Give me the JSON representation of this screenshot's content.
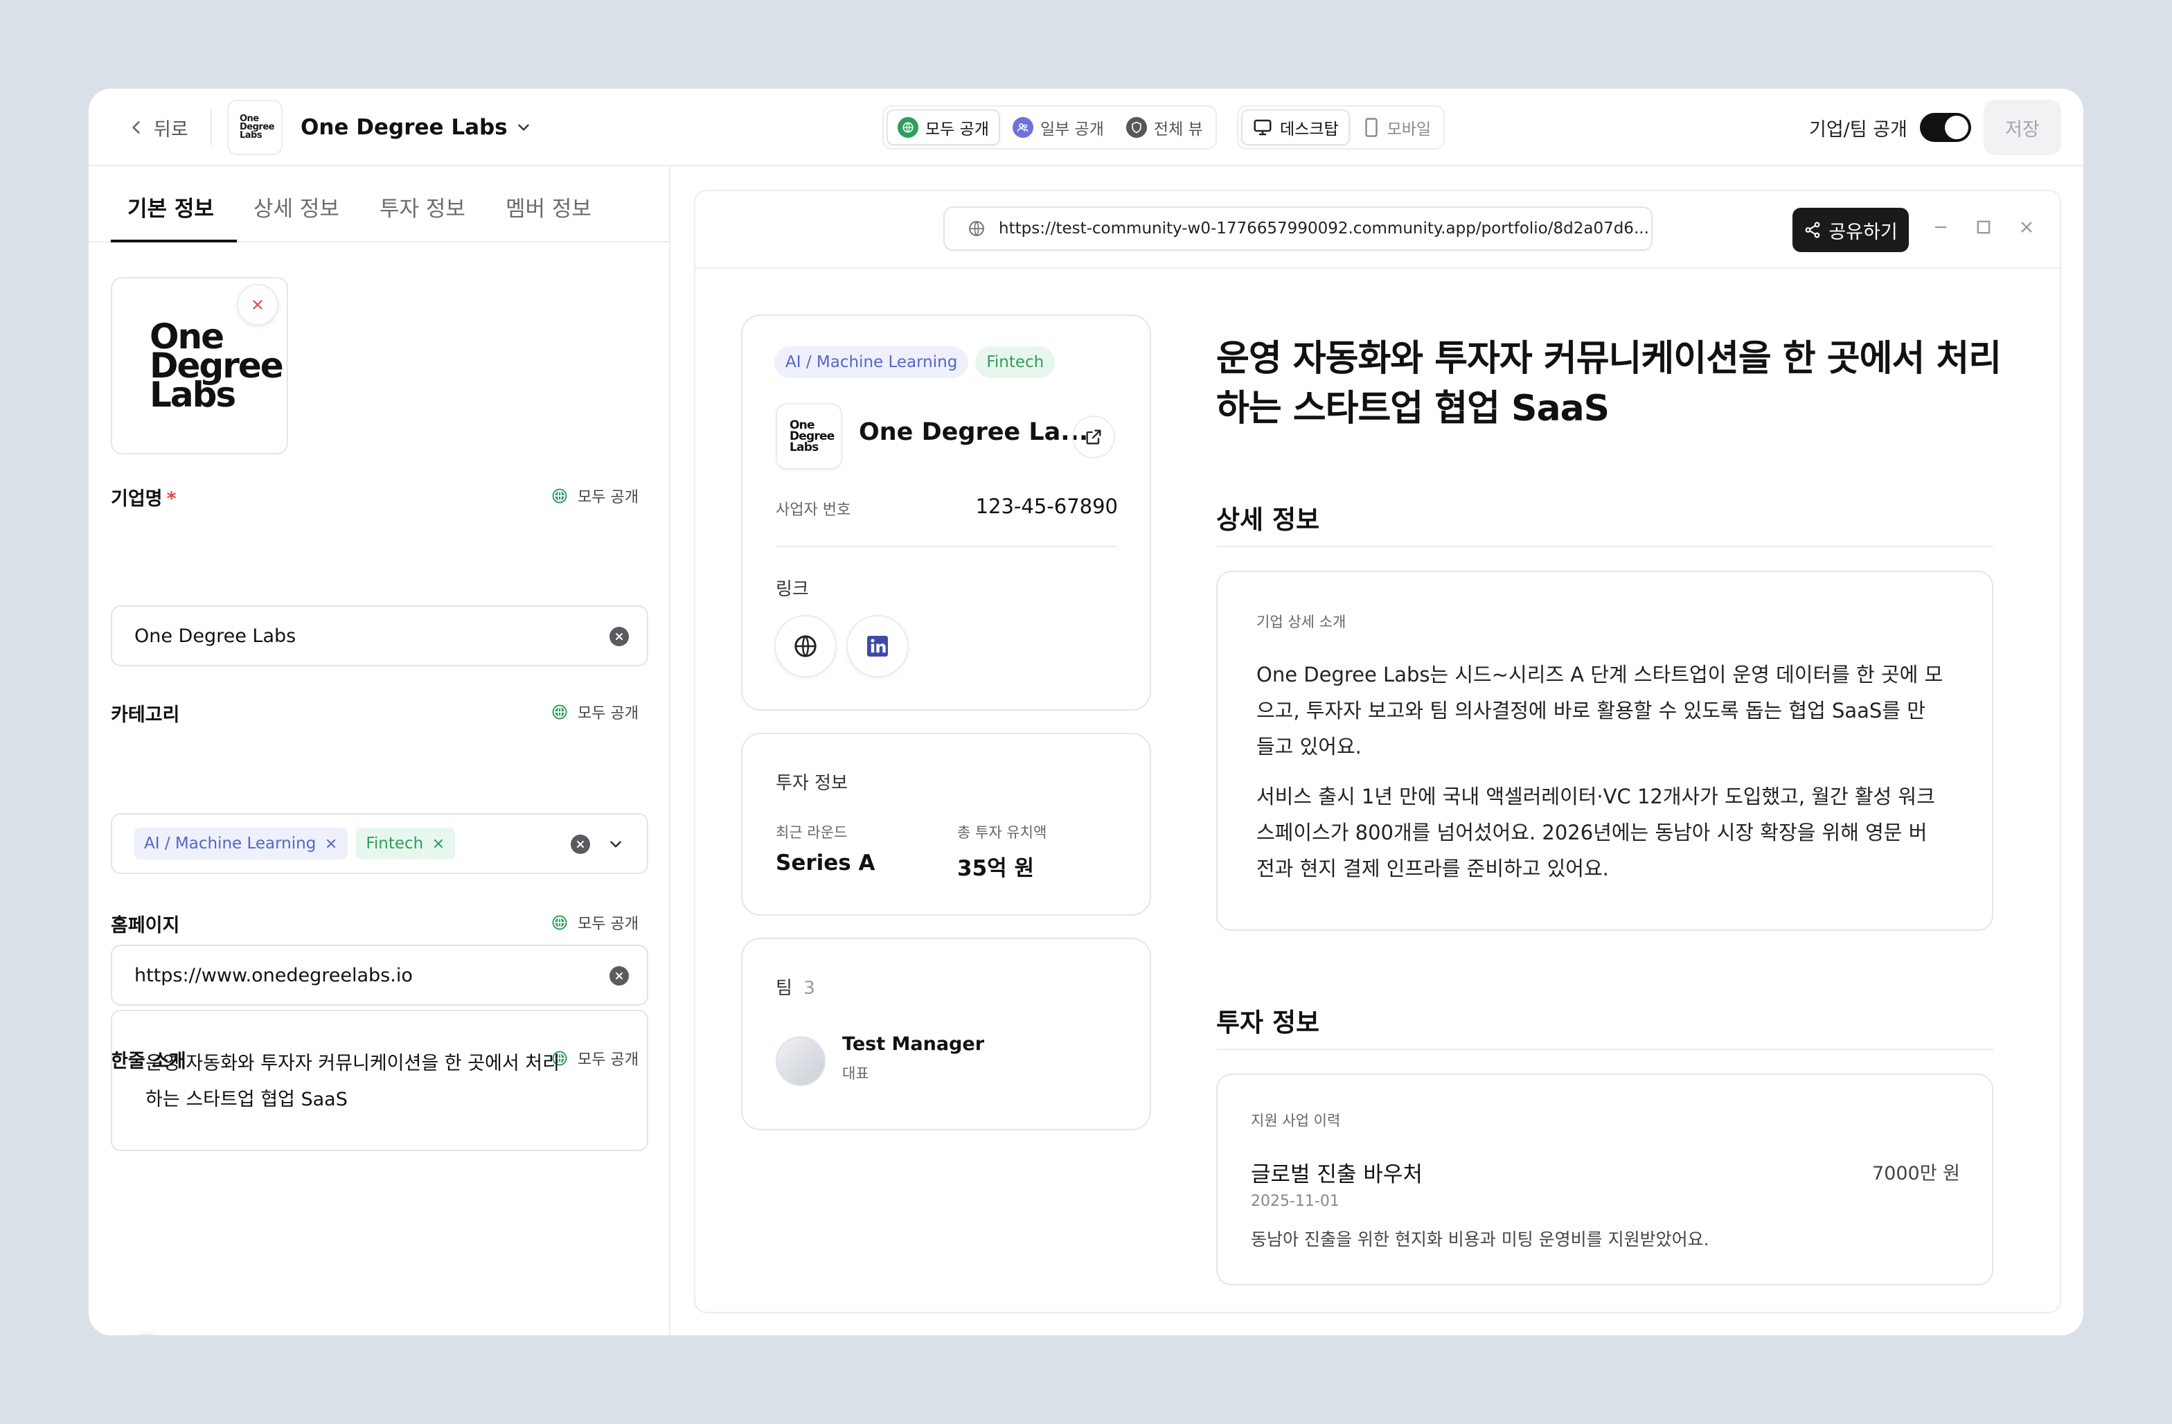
{
  "topbar": {
    "back_label": "뒤로",
    "company_name": "One Degree Labs",
    "logo_text": [
      "One",
      "Degree",
      "Labs"
    ],
    "visibility": [
      "모두 공개",
      "일부 공개",
      "전체 뷰"
    ],
    "devices": [
      "데스크탑",
      "모바일"
    ],
    "public_toggle_label": "기업/팀 공개",
    "save_label": "저장"
  },
  "left": {
    "tabs": [
      "기본 정보",
      "상세 정보",
      "투자 정보",
      "멤버 정보"
    ],
    "logo_text": [
      "One",
      "Degree",
      "Labs"
    ],
    "fields": {
      "name": {
        "label": "기업명",
        "required": "*",
        "visibility": "모두 공개",
        "value": "One Degree Labs"
      },
      "category": {
        "label": "카테고리",
        "visibility": "모두 공개",
        "chips": [
          "AI / Machine Learning",
          "Fintech"
        ]
      },
      "homepage": {
        "label": "홈페이지",
        "visibility": "모두 공개",
        "value": "https://www.onedegreelabs.io"
      },
      "intro": {
        "label": "한줄 소개",
        "visibility": "모두 공개",
        "lines": [
          "운영 자동화와 투자자 커뮤니케이션을 한 곳에서 처리",
          "하는 스타트업 협업 SaaS"
        ]
      }
    }
  },
  "preview": {
    "url": "https://test-community-w0-1776657990092.community.app/portfolio/8d2a07d6...",
    "share_label": "공유하기",
    "profile": {
      "tags": [
        "AI / Machine Learning",
        "Fintech"
      ],
      "logo_text": [
        "One",
        "Degree",
        "Labs"
      ],
      "name": "One Degree La...",
      "biz_no_label": "사업자 번호",
      "biz_no": "123-45-67890",
      "links_label": "링크"
    },
    "invest_card": {
      "title": "투자 정보",
      "round_label": "최근 라운드",
      "round_value": "Series A",
      "total_label": "총 투자 유치액",
      "total_value": "35억 원"
    },
    "team_card": {
      "title": "팀",
      "count": "3",
      "member_name": "Test Manager",
      "member_role": "대표"
    },
    "hero_lines": [
      "운영 자동화와 투자자 커뮤니케이션을 한 곳에서 처리",
      "하는 스타트업 협업 SaaS"
    ],
    "detail": {
      "section_title": "상세 정보",
      "card_label": "기업 상세 소개",
      "para1": [
        "One Degree Labs는 시드~시리즈 A 단계 스타트업이 운영 데이터를 한 곳에 모",
        "으고, 투자자 보고와 팀 의사결정에 바로 활용할 수 있도록 돕는 협업 SaaS를 만",
        "들고 있어요."
      ],
      "para2": [
        "서비스 출시 1년 만에 국내 액셀러레이터·VC 12개사가 도입했고, 월간 활성 워크",
        "스페이스가 800개를 넘어섰어요. 2026년에는 동남아 시장 확장을 위해 영문 버",
        "전과 현지 결제 인프라를 준비하고 있어요."
      ]
    },
    "investment": {
      "section_title": "투자 정보",
      "card_label": "지원 사업 이력",
      "item_title": "글로벌 진출 바우처",
      "item_amount": "7000만 원",
      "item_date": "2025-11-01",
      "item_desc": "동남아 진출을 위한 현지화 비용과 미팅 운영비를 지원받았어요."
    }
  },
  "colors": {
    "accent_green": "#2e9d5d",
    "accent_blue": "#5a63c9",
    "purple": "#6b72d8",
    "dark": "#1a1a1a",
    "required": "#e5484d"
  }
}
